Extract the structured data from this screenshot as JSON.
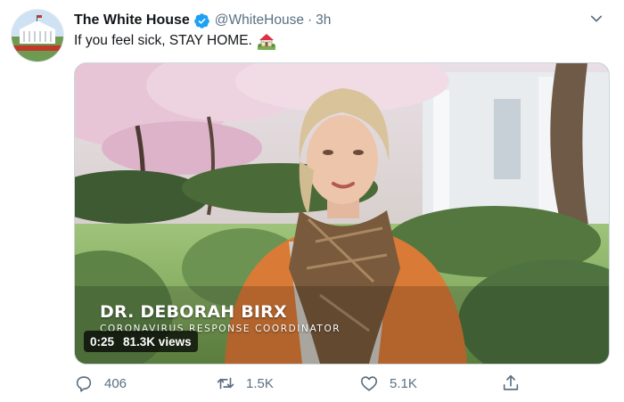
{
  "tweet": {
    "author_name": "The White House",
    "handle": "@WhiteHouse",
    "separator": "·",
    "time": "3h",
    "text": "If you feel sick, STAY HOME.",
    "icons": {
      "avatar": "white-house-avatar",
      "verified": "verified-badge-icon",
      "menu": "chevron-down-icon",
      "emoji": "house-with-garden-emoji"
    }
  },
  "video": {
    "lower_third_name": "DR. DEBORAH BIRX",
    "lower_third_title": "CORONAVIRUS RESPONSE COORDINATOR",
    "duration": "0:25",
    "views": "81.3K views"
  },
  "actions": {
    "reply_count": "406",
    "retweet_count": "1.5K",
    "like_count": "5.1K",
    "icons": [
      "reply-icon",
      "retweet-icon",
      "like-icon",
      "share-icon"
    ]
  },
  "colors": {
    "verified_blue": "#1da1f2",
    "secondary_text": "#5b7083",
    "primary_text": "#14171a"
  }
}
